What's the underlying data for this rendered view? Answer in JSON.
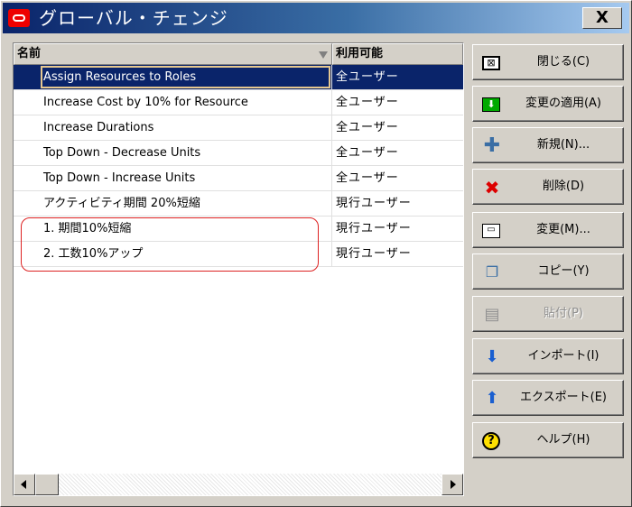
{
  "window": {
    "title": "グローバル・チェンジ",
    "close_label": "X"
  },
  "list": {
    "columns": {
      "name": "名前",
      "availability": "利用可能"
    },
    "rows": [
      {
        "name": "Assign Resources to Roles",
        "availability": "全ユーザー",
        "selected": true
      },
      {
        "name": "Increase Cost by 10% for Resource",
        "availability": "全ユーザー",
        "selected": false
      },
      {
        "name": "Increase Durations",
        "availability": "全ユーザー",
        "selected": false
      },
      {
        "name": "Top Down - Decrease Units",
        "availability": "全ユーザー",
        "selected": false
      },
      {
        "name": "Top Down - Increase Units",
        "availability": "全ユーザー",
        "selected": false
      },
      {
        "name": "アクティビティ期間 20%短縮",
        "availability": "現行ユーザー",
        "selected": false
      },
      {
        "name": "1. 期間10%短縮",
        "availability": "現行ユーザー",
        "selected": false
      },
      {
        "name": "2. 工数10%アップ",
        "availability": "現行ユーザー",
        "selected": false
      }
    ],
    "highlight_color": "#dd2222",
    "selection_color": "#0a246a"
  },
  "buttons": {
    "close": "閉じる(C)",
    "apply": "変更の適用(A)",
    "new": "新規(N)...",
    "delete": "削除(D)",
    "modify": "変更(M)...",
    "copy": "コピー(Y)",
    "paste": "貼付(P)",
    "import": "インポート(I)",
    "export": "エクスポート(E)",
    "help": "ヘルプ(H)"
  },
  "icons": {
    "close": "close-window-icon",
    "apply": "apply-icon",
    "new": "plus-icon",
    "delete": "delete-x-icon",
    "modify": "edit-icon",
    "copy": "copy-icon",
    "paste": "paste-icon",
    "import": "import-arrow-icon",
    "export": "export-arrow-icon",
    "help": "help-icon"
  }
}
